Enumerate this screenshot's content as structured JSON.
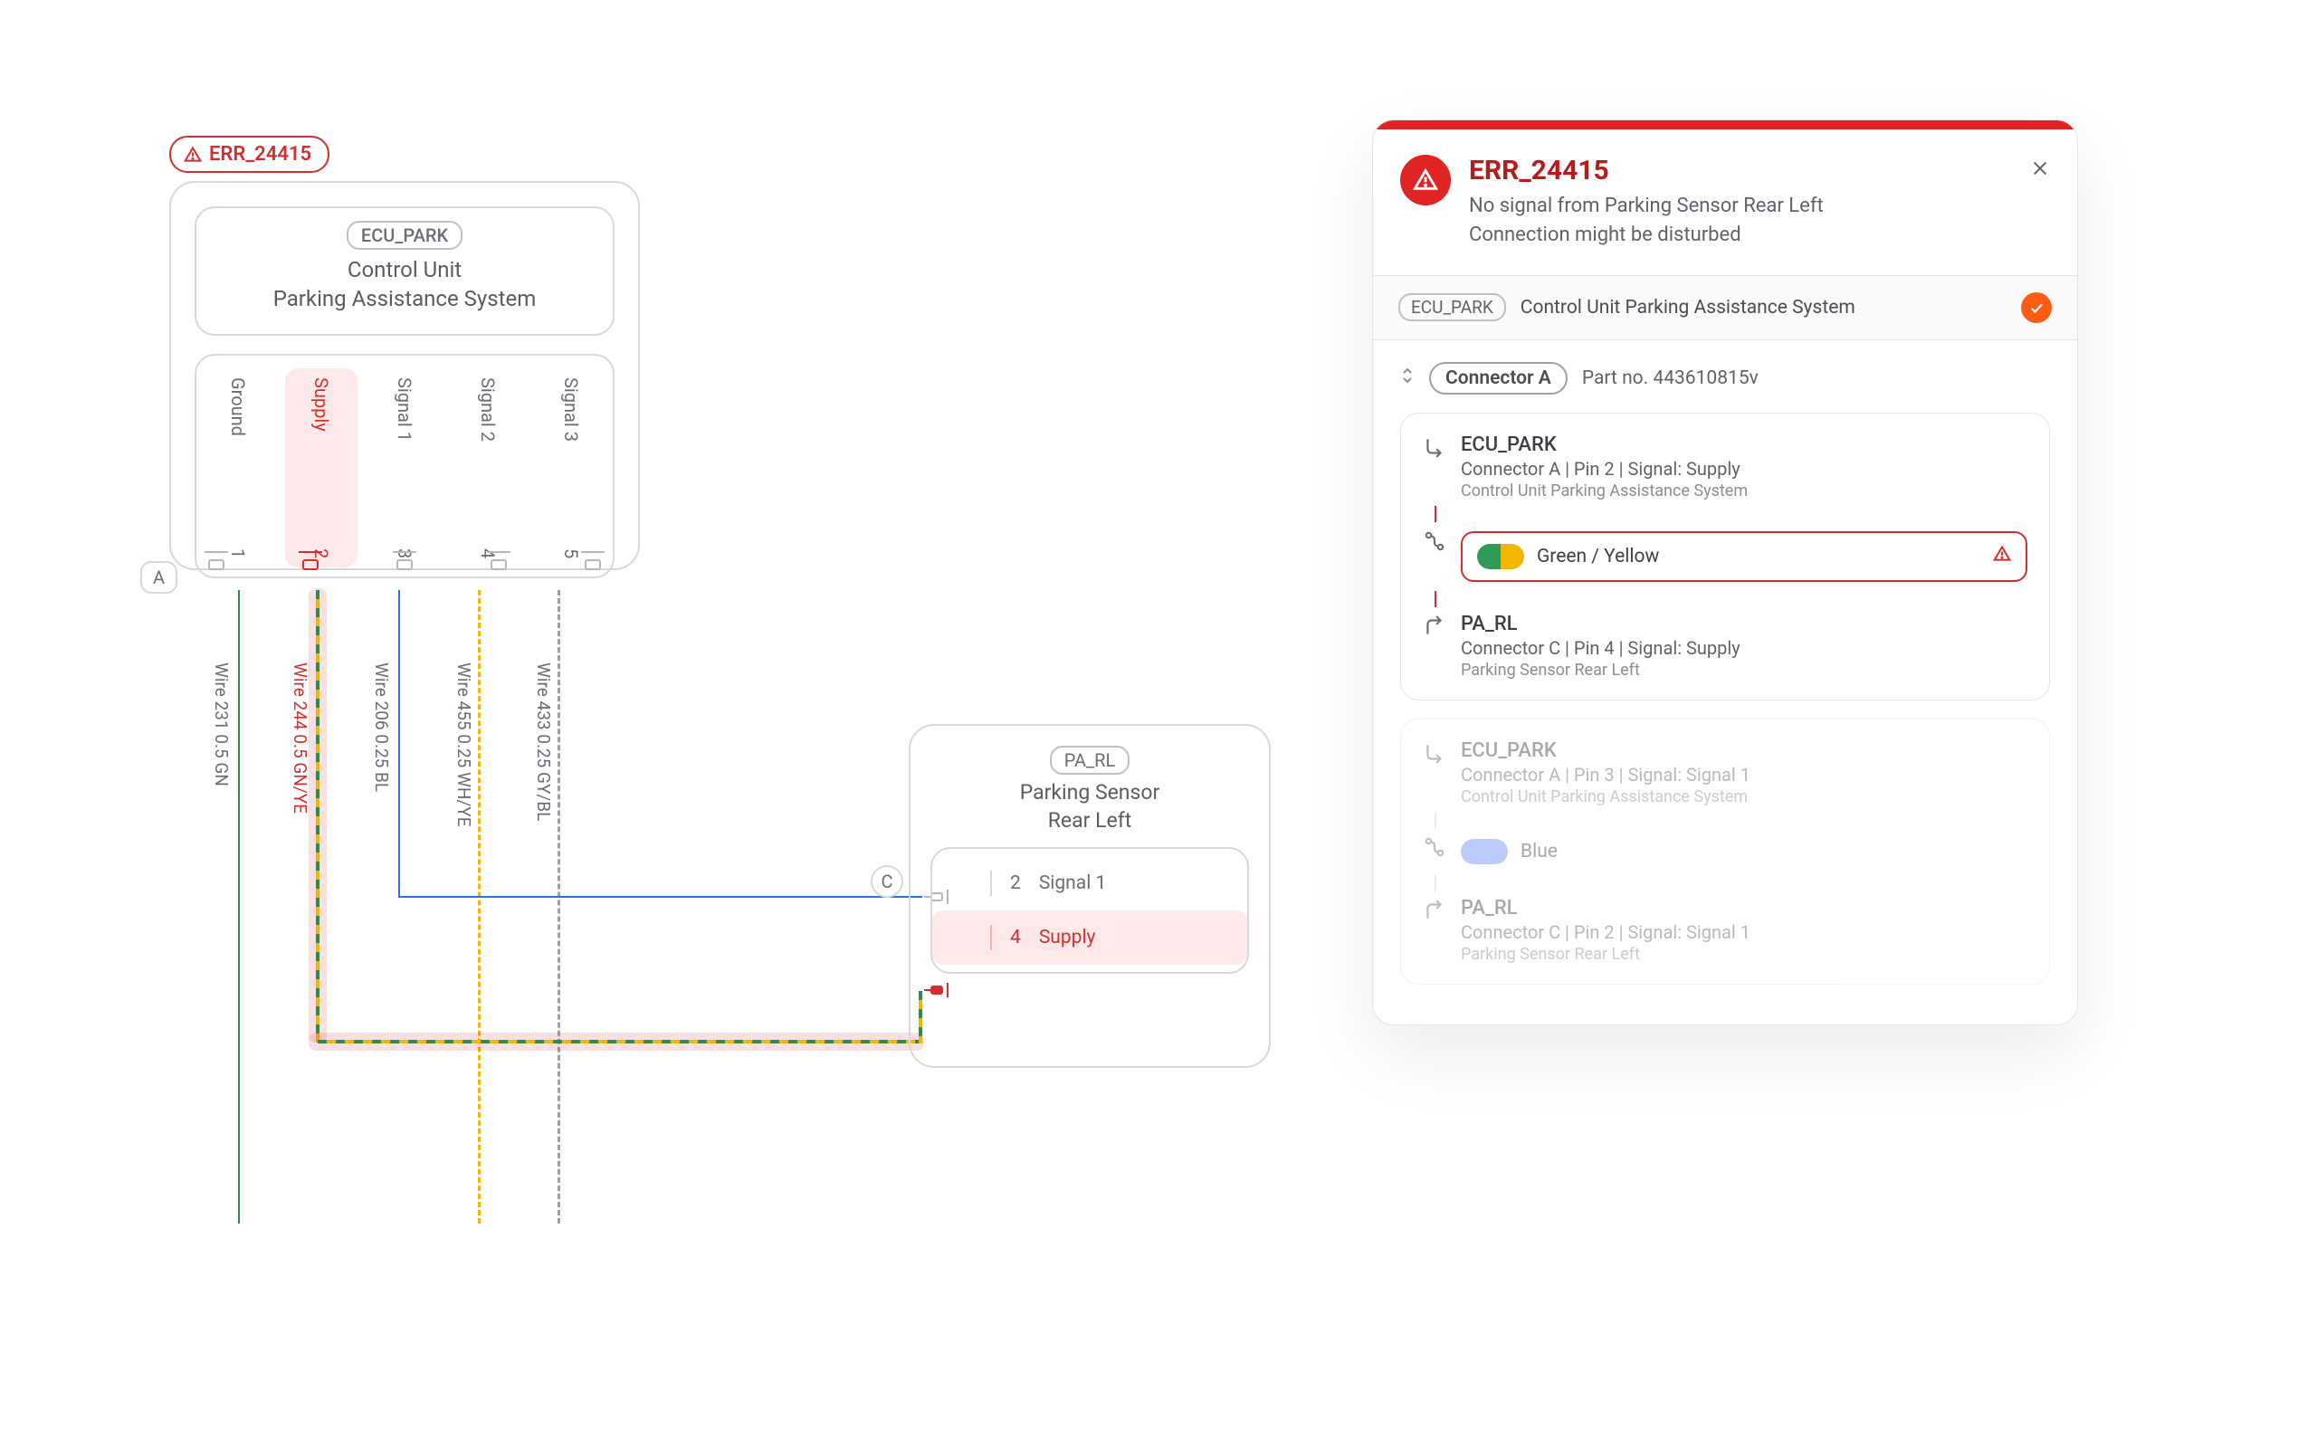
{
  "error_badge": "ERR_24415",
  "ecu": {
    "chip": "ECU_PARK",
    "title_line1": "Control Unit",
    "title_line2": "Parking Assistance System",
    "pins": [
      {
        "label": "Ground",
        "num": "1"
      },
      {
        "label": "Supply",
        "num": "2",
        "active": true
      },
      {
        "label": "Signal 1",
        "num": "3"
      },
      {
        "label": "Signal 2",
        "num": "4"
      },
      {
        "label": "Signal 3",
        "num": "5"
      }
    ],
    "connector_label": "A"
  },
  "wires": [
    {
      "text": "Wire 231  0.5  GN"
    },
    {
      "text": "Wire 244  0.5  GN/YE"
    },
    {
      "text": "Wire 206  0.25  BL"
    },
    {
      "text": "Wire 455  0.25  WH/YE"
    },
    {
      "text": "Wire 433  0.25  GY/BL"
    }
  ],
  "parl": {
    "chip": "PA_RL",
    "title_line1": "Parking Sensor",
    "title_line2": "Rear Left",
    "connector_label": "C",
    "rows": [
      {
        "num": "2",
        "text": "Signal 1"
      },
      {
        "num": "4",
        "text": "Supply",
        "active": true
      }
    ]
  },
  "panel": {
    "title": "ERR_24415",
    "desc_line1": "No signal from Parking Sensor Rear Left",
    "desc_line2": "Connection might be disturbed",
    "sub_chip": "ECU_PARK",
    "sub_text": "Control Unit Parking Assistance System",
    "connector_label": "Connector A",
    "part_text": "Part no. 443610815v",
    "cards": [
      {
        "top_title": "ECU_PARK",
        "top_sub": "Connector A | Pin 2 | Signal: Supply",
        "top_small": "Control Unit Parking Assistance System",
        "color_text": "Green / Yellow",
        "color": "gy",
        "error": true,
        "bot_title": "PA_RL",
        "bot_sub": "Connector C | Pin 4 | Signal: Supply",
        "bot_small": "Parking Sensor Rear Left"
      },
      {
        "top_title": "ECU_PARK",
        "top_sub": "Connector A | Pin 3 | Signal: Signal 1",
        "top_small": "Control Unit Parking Assistance System",
        "color_text": "Blue",
        "color": "bl",
        "error": false,
        "bot_title": "PA_RL",
        "bot_sub": "Connector C | Pin 2 | Signal: Signal 1",
        "bot_small": "Parking Sensor Rear Left"
      }
    ]
  }
}
